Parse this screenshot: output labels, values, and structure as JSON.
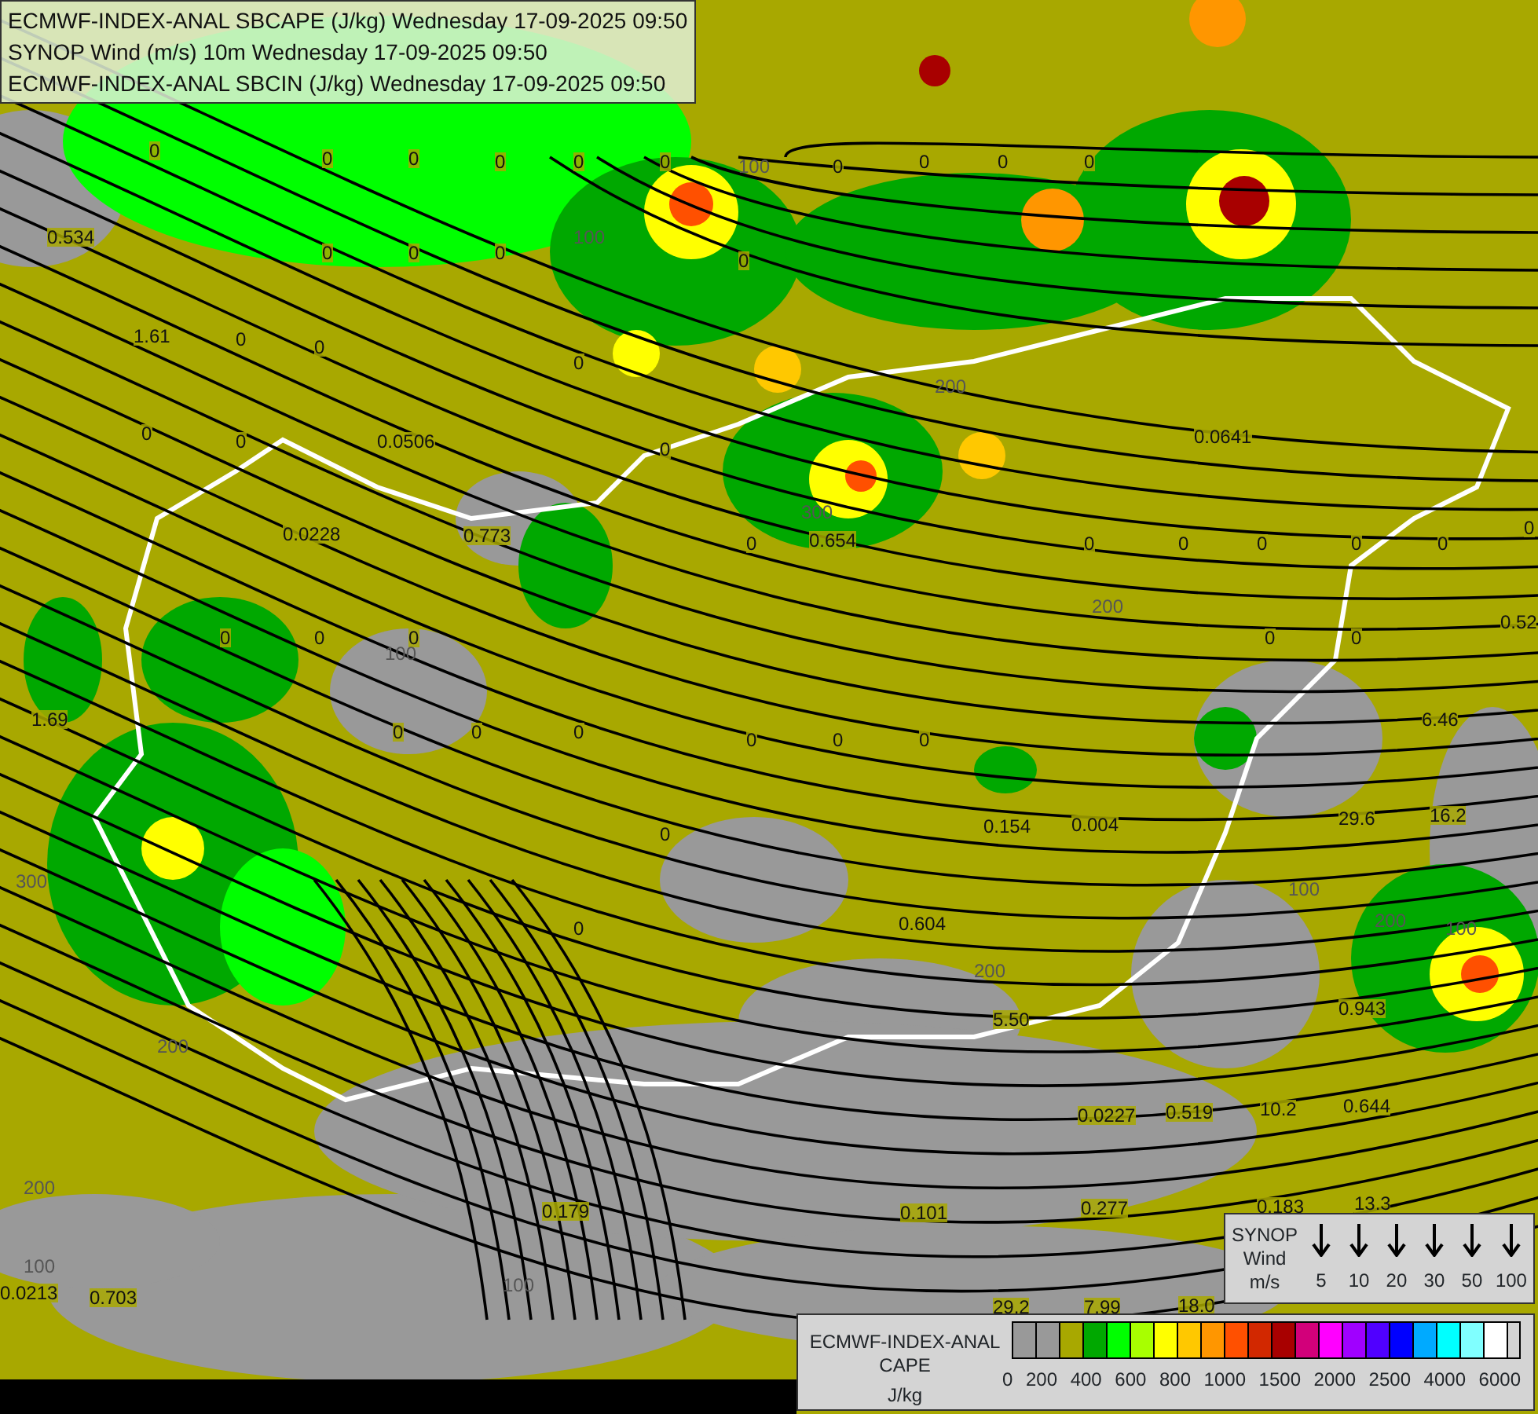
{
  "header_lines": [
    "ECMWF-INDEX-ANAL SBCAPE (J/kg) Wednesday 17-09-2025 09:50",
    "SYNOP Wind (m/s) 10m Wednesday 17-09-2025 09:50",
    "ECMWF-INDEX-ANAL SBCIN (J/kg) Wednesday 17-09-2025 09:50"
  ],
  "station_values": [
    "0.534",
    "1.61",
    "0.0506",
    "0.0228",
    "0.773",
    "0.654",
    "0.0641",
    "1.69",
    "6.46",
    "29.6",
    "16.2",
    "0.154",
    "0.604",
    "5.50",
    "0.943",
    "0.644",
    "0.0227",
    "0.519",
    "10.2",
    "0.179",
    "0.101",
    "0.277",
    "0.183",
    "13.3",
    "29.2",
    "7.99",
    "18.0",
    "0.0213",
    "0.703",
    "0.52",
    "0.004"
  ],
  "zero_values": [
    "0",
    "0",
    "0",
    "0",
    "0",
    "0",
    "0",
    "0",
    "0",
    "0",
    "0",
    "0",
    "0",
    "0",
    "0",
    "0",
    "0",
    "0",
    "0",
    "0",
    "0",
    "0",
    "0",
    "0",
    "0",
    "0",
    "0",
    "0",
    "0",
    "0",
    "0",
    "0",
    "0",
    "0",
    "0",
    "0",
    "0",
    "0",
    "0",
    "0"
  ],
  "contour_labels": [
    "100",
    "100",
    "200",
    "300",
    "100",
    "200",
    "200",
    "100",
    "100",
    "200",
    "200",
    "100",
    "300",
    "200",
    "100"
  ],
  "wind_legend": {
    "title": "SYNOP",
    "label": "Wind",
    "unit": "m/s",
    "speeds": [
      "5",
      "10",
      "20",
      "30",
      "50",
      "100"
    ]
  },
  "cape_legend": {
    "title_lines": [
      "ECMWF-INDEX-ANAL",
      "CAPE"
    ],
    "unit": "J/kg",
    "swatches": [
      {
        "color": "#999999"
      },
      {
        "color": "#999999"
      },
      {
        "color": "#a8a800"
      },
      {
        "color": "#00a800"
      },
      {
        "color": "#00ff00"
      },
      {
        "color": "#a8ff00"
      },
      {
        "color": "#ffff00"
      },
      {
        "color": "#ffc800"
      },
      {
        "color": "#ff9600"
      },
      {
        "color": "#ff5000"
      },
      {
        "color": "#d22800"
      },
      {
        "color": "#a80000"
      },
      {
        "color": "#d2007a"
      },
      {
        "color": "#ff00ff"
      },
      {
        "color": "#a000ff"
      },
      {
        "color": "#5000ff"
      },
      {
        "color": "#0000ff"
      },
      {
        "color": "#00aaff"
      },
      {
        "color": "#00ffff"
      },
      {
        "color": "#80ffff"
      },
      {
        "color": "#ffffff"
      }
    ],
    "ticks": [
      "0",
      "200",
      "400",
      "600",
      "800",
      "1000",
      "1500",
      "2000",
      "2500",
      "4000",
      "6000"
    ]
  }
}
